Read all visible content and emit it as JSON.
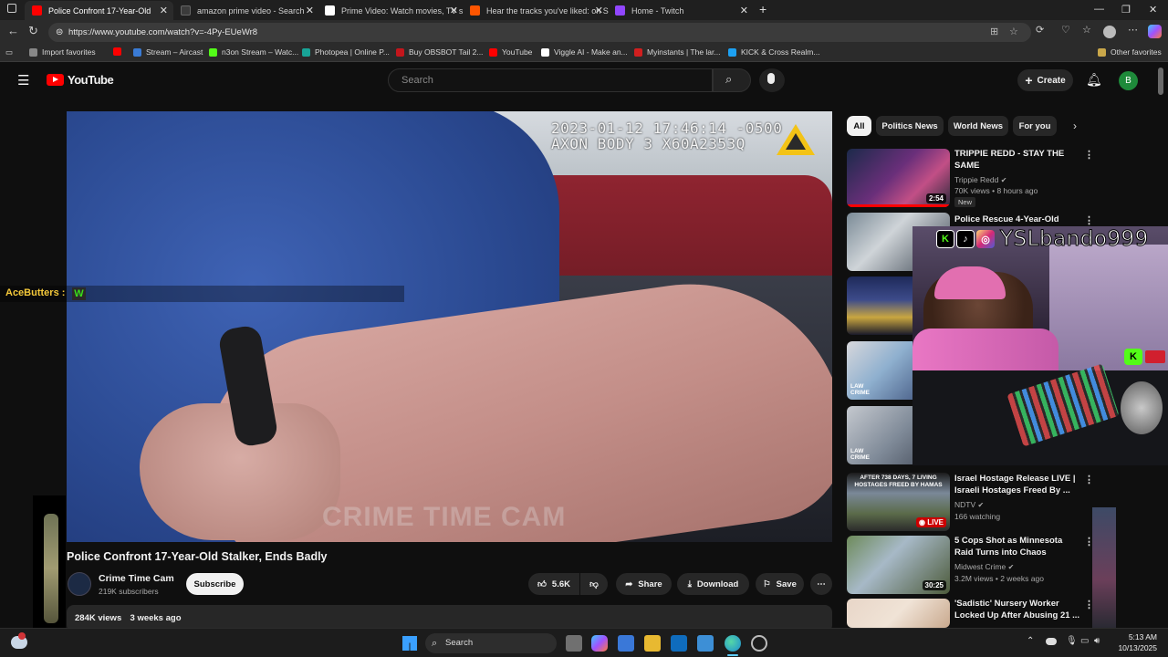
{
  "browser": {
    "tabs": [
      {
        "title": "Police Confront 17-Year-Old",
        "active": true,
        "color": "#ff0000"
      },
      {
        "title": "amazon prime video - Search",
        "active": false,
        "color": "#3b3b3b"
      },
      {
        "title": "Prime Video: Watch movies, TV sh",
        "active": false,
        "color": "#ffffff"
      },
      {
        "title": "Hear the tracks you've liked: on S",
        "active": false,
        "color": "#ff5500"
      },
      {
        "title": "Home - Twitch",
        "active": false,
        "color": "#9146ff"
      }
    ],
    "url": "https://www.youtube.com/watch?v=-4Py-EUeWr8",
    "bookmarks": [
      {
        "label": "Import favorites",
        "color": "#888888"
      },
      {
        "label": "",
        "color": "#ff0000"
      },
      {
        "label": "Stream – Aircast",
        "color": "#3a7bd5"
      },
      {
        "label": "n3on Stream – Watc...",
        "color": "#53fc18"
      },
      {
        "label": "Photopea | Online P...",
        "color": "#18a497"
      },
      {
        "label": "Buy OBSBOT Tail 2...",
        "color": "#c4161c"
      },
      {
        "label": "YouTube",
        "color": "#ff0000"
      },
      {
        "label": "Viggle AI - Make an...",
        "color": "#ffffff"
      },
      {
        "label": "Myinstants | The lar...",
        "color": "#d11f1f"
      },
      {
        "label": "KICK & Cross Realm...",
        "color": "#1da1f2"
      }
    ],
    "other_favorites": "Other favorites"
  },
  "youtube": {
    "logo_text": "YouTube",
    "search_placeholder": "Search",
    "create_label": "Create",
    "avatar_letter": "B"
  },
  "video": {
    "overlay_timestamp_line1": "2023-01-12 17:46:14 -0500",
    "overlay_timestamp_line2": "AXON BODY 3 X60A2353Q",
    "watermark": "CRIME TIME CAM",
    "title": "Police Confront 17-Year-Old Stalker, Ends Badly",
    "channel": "Crime Time Cam",
    "subscribers": "219K subscribers",
    "subscribe_label": "Subscribe",
    "likes": "5.6K",
    "share_label": "Share",
    "download_label": "Download",
    "save_label": "Save",
    "views": "284K views",
    "age": "3 weeks ago"
  },
  "chat_overlay": {
    "username": "AceButters :",
    "emote_text": "W"
  },
  "chips": [
    {
      "label": "All",
      "active": true
    },
    {
      "label": "Politics News",
      "active": false
    },
    {
      "label": "World News",
      "active": false
    },
    {
      "label": "For you",
      "active": false
    }
  ],
  "recommendations": [
    {
      "title": "TRIPPIE REDD - STAY THE SAME",
      "channel": "Trippie Redd",
      "meta": "70K views • 8 hours ago",
      "badge": "New",
      "duration": "2:54"
    },
    {
      "title": "Police Rescue 4-Year-Old From",
      "channel": "",
      "meta": "",
      "badge": "",
      "duration": ""
    },
    {
      "title": "",
      "channel": "",
      "meta": "",
      "badge": "",
      "duration": ""
    },
    {
      "title": "",
      "channel": "",
      "meta": "",
      "badge": "",
      "duration": "",
      "thumb_text": "LAW CRIME"
    },
    {
      "title": "",
      "channel": "",
      "meta": "",
      "badge": "",
      "duration": "",
      "thumb_text": "LAW CRIME"
    },
    {
      "title": "Israel Hostage Release LIVE | Israeli Hostages Freed By ...",
      "channel": "NDTV",
      "meta": "166 watching",
      "badge": "",
      "duration": "LIVE",
      "thumb_text": "AFTER 738 DAYS, 7 LIVING HOSTAGES FREED BY HAMAS"
    },
    {
      "title": "5 Cops Shot as Minnesota Raid Turns into Chaos",
      "channel": "Midwest Crime",
      "meta": "3.2M views • 2 weeks ago",
      "badge": "",
      "duration": "30:25"
    },
    {
      "title": "'Sadistic' Nursery Worker Locked Up After Abusing 21 ...",
      "channel": "",
      "meta": "",
      "badge": "",
      "duration": ""
    }
  ],
  "webcam_overlay": {
    "handle": "YSLbando999",
    "platform_letter": "K"
  },
  "taskbar": {
    "search_placeholder": "Search",
    "time": "5:13 AM",
    "date": "10/13/2025"
  }
}
